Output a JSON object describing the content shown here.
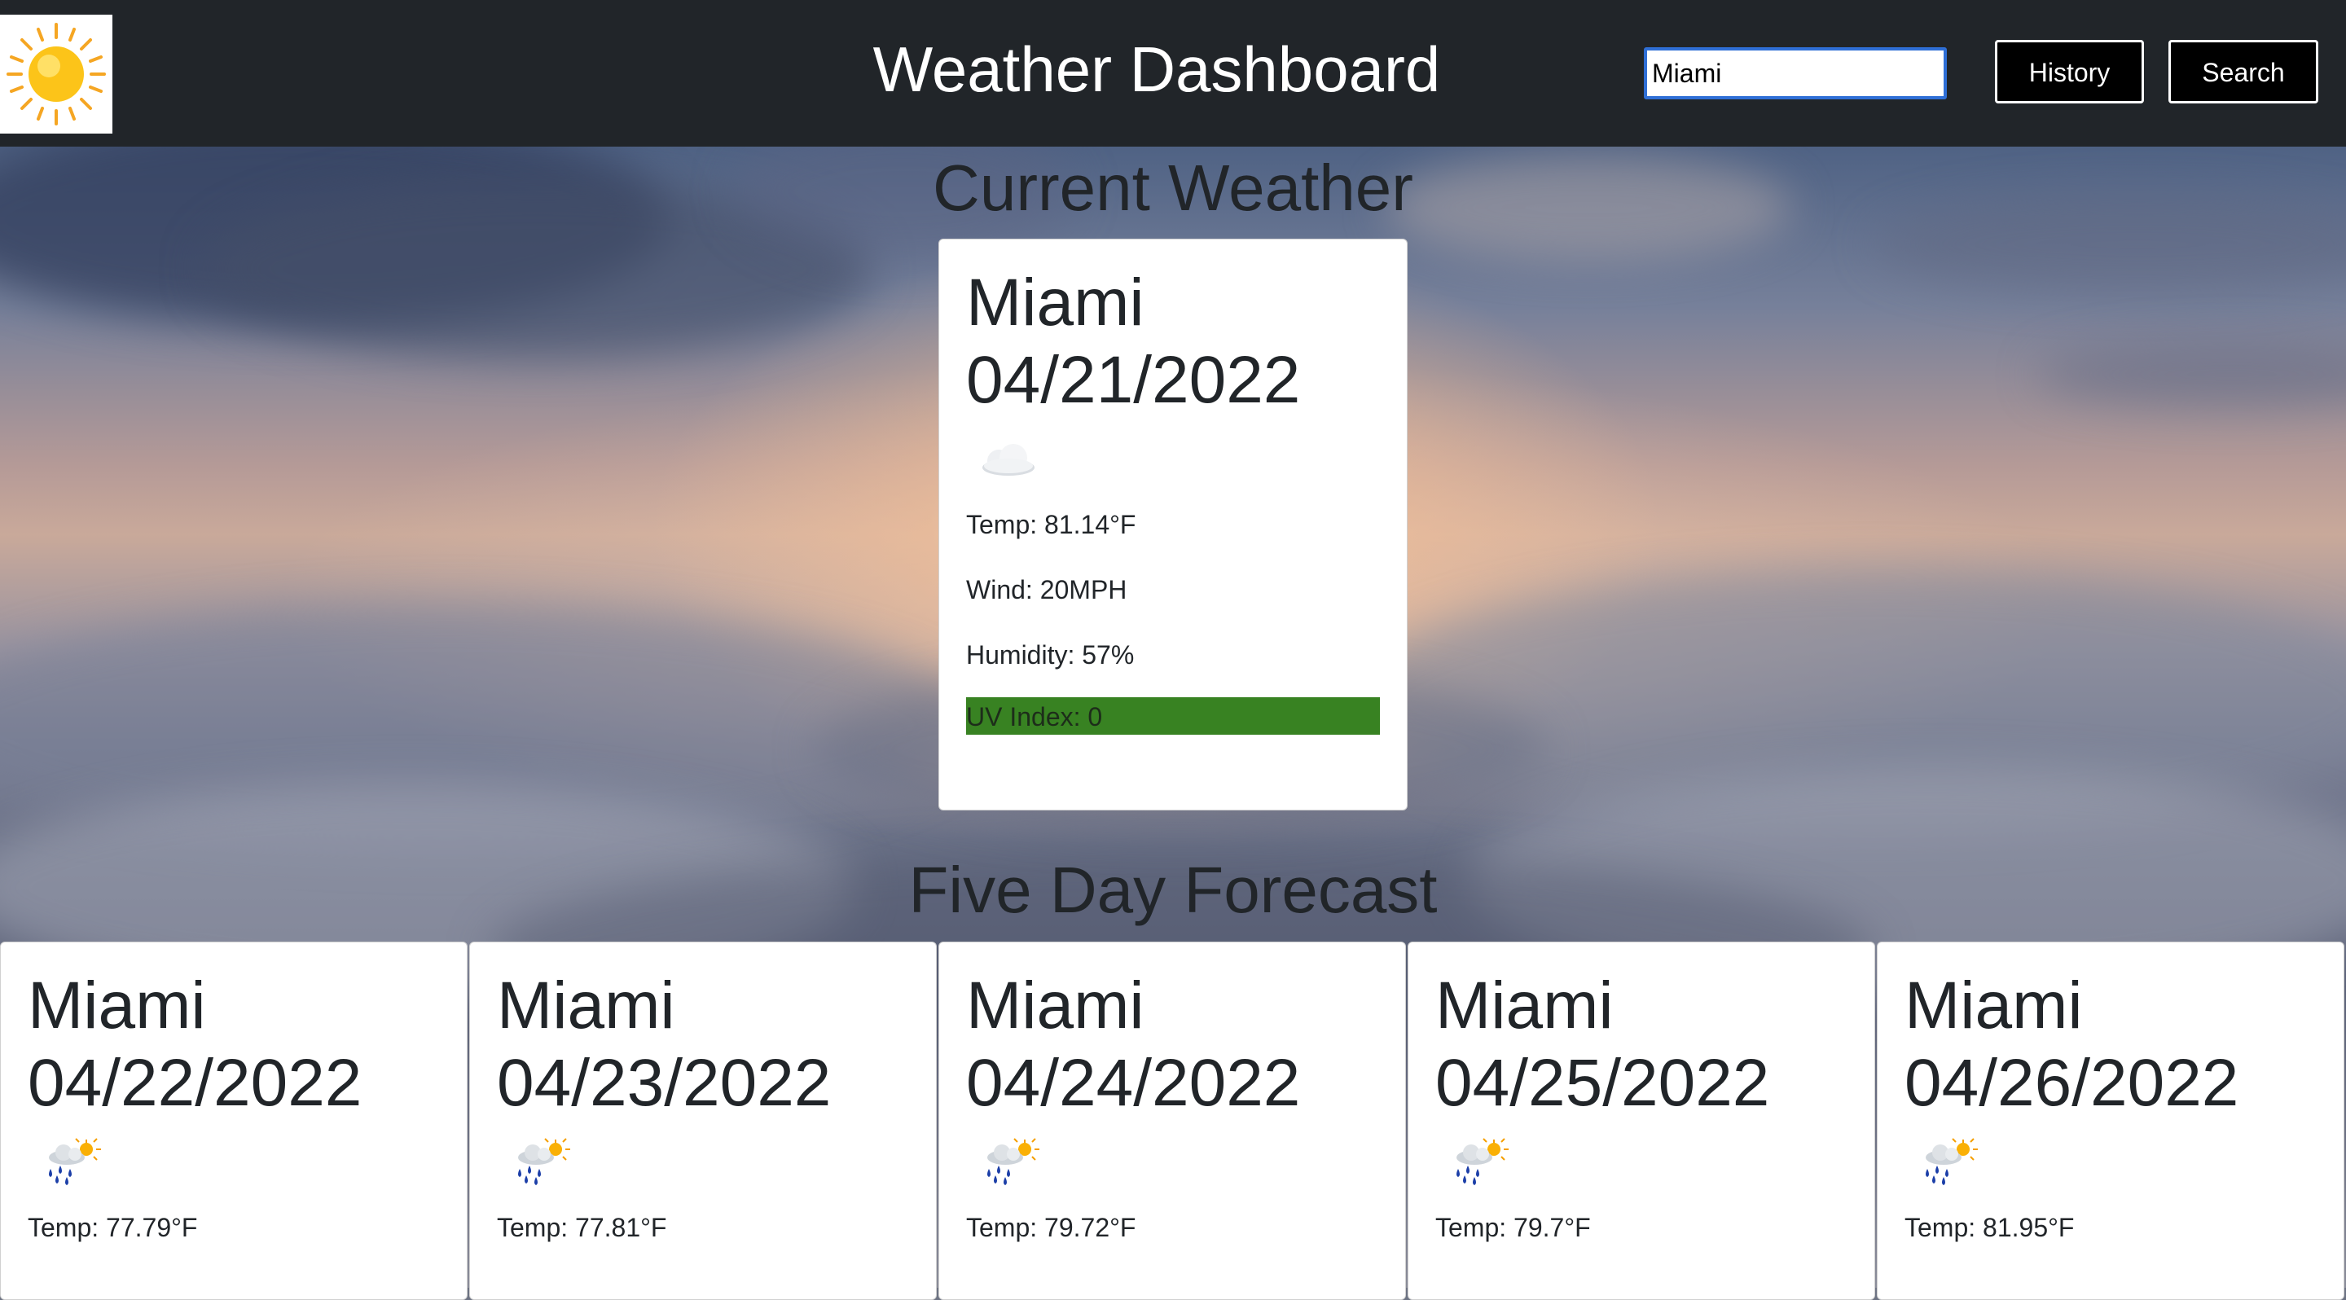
{
  "header": {
    "logo_icon": "sun-icon",
    "title": "Weather Dashboard",
    "search": {
      "value": "Miami",
      "placeholder": ""
    },
    "history_label": "History",
    "search_label": "Search"
  },
  "current": {
    "heading": "Current Weather",
    "city": "Miami",
    "date": "04/21/2022",
    "icon": "cloud-icon",
    "temp": "Temp: 81.14°F",
    "wind": "Wind: 20MPH",
    "humidity": "Humidity: 57%",
    "uv": "UV Index: 0",
    "uv_color": "#388222"
  },
  "forecast": {
    "heading": "Five Day Forecast",
    "days": [
      {
        "city": "Miami",
        "date": "04/22/2022",
        "icon": "rain-sun-icon",
        "temp": "Temp: 77.79°F"
      },
      {
        "city": "Miami",
        "date": "04/23/2022",
        "icon": "rain-sun-icon",
        "temp": "Temp: 77.81°F"
      },
      {
        "city": "Miami",
        "date": "04/24/2022",
        "icon": "rain-sun-icon",
        "temp": "Temp: 79.72°F"
      },
      {
        "city": "Miami",
        "date": "04/25/2022",
        "icon": "rain-sun-icon",
        "temp": "Temp: 79.7°F"
      },
      {
        "city": "Miami",
        "date": "04/26/2022",
        "icon": "rain-sun-icon",
        "temp": "Temp: 81.95°F"
      }
    ]
  },
  "colors": {
    "navbar": "#212529",
    "input_focus": "#2f6fd6",
    "card_bg": "#ffffff"
  }
}
